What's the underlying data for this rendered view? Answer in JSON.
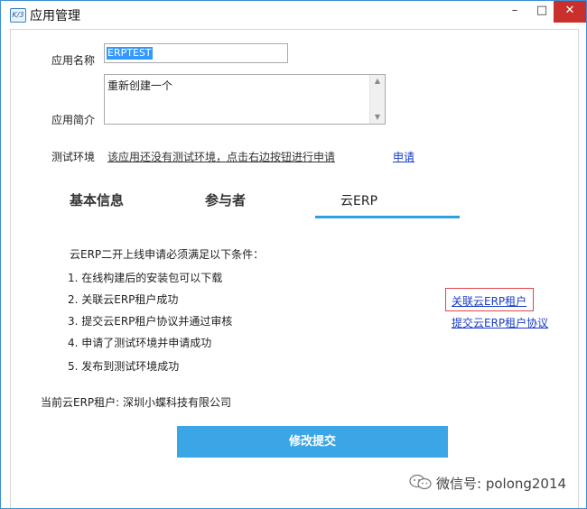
{
  "window": {
    "title": "应用管理",
    "icon_text": "K/3",
    "minimize": "–",
    "maximize": "□",
    "close": "✕"
  },
  "form": {
    "name_label": "应用名称",
    "name_value": "ERPTEST",
    "desc_label": "应用简介",
    "desc_value": "重新创建一个",
    "test_env_label": "测试环境",
    "test_env_text": "该应用还没有测试环境，点击右边按钮进行申请",
    "apply_link": "申请"
  },
  "tabs": [
    {
      "label": "基本信息",
      "active": false
    },
    {
      "label": "参与者",
      "active": false
    },
    {
      "label": "云ERP",
      "active": true
    }
  ],
  "conditions": {
    "title": "云ERP二开上线申请必须满足以下条件：",
    "items": [
      "1. 在线构建后的安装包可以下载",
      "2. 关联云ERP租户成功",
      "3. 提交云ERP租户协议并通过审核",
      "4. 申请了测试环境并申请成功",
      "5. 发布到测试环境成功"
    ]
  },
  "links": {
    "associate_tenant": "关联云ERP租户",
    "submit_agreement": "提交云ERP租户协议"
  },
  "tenant": "当前云ERP租户: 深圳小蝶科技有限公司",
  "submit_label": "修改提交",
  "watermark": "微信号: polong2014",
  "colors": {
    "accent": "#3ba6e6",
    "tab_underline": "#2e9fe0",
    "link": "#1a3cc8",
    "highlight_box": "#e0474c",
    "close_button": "#c9302c"
  }
}
